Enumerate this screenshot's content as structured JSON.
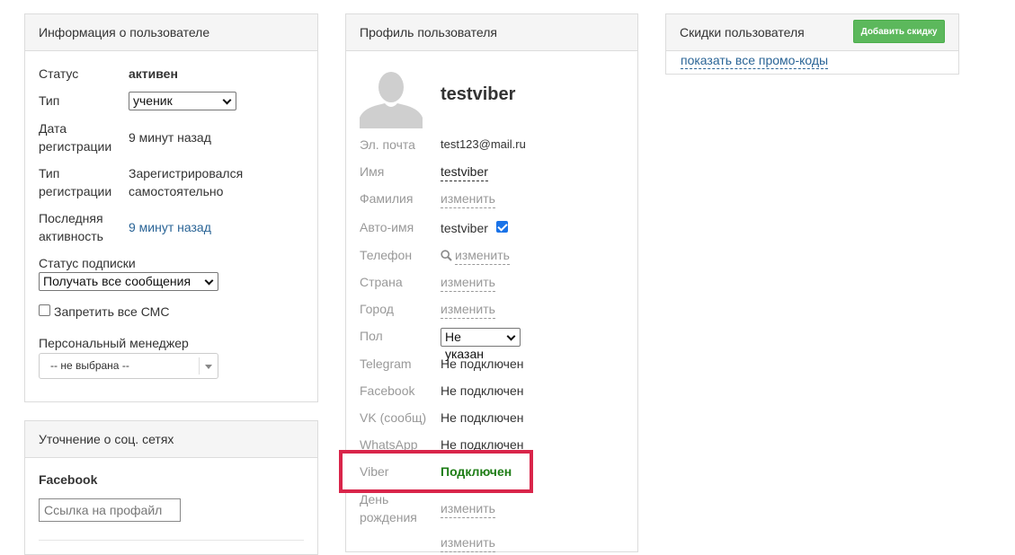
{
  "user_info": {
    "title": "Информация о пользователе",
    "status_label": "Статус",
    "status_value": "активен",
    "type_label": "Тип",
    "type_value": "ученик",
    "reg_date_label_1": "Дата",
    "reg_date_label_2": "регистрации",
    "reg_date_value": "9 минут назад",
    "reg_type_label_1": "Тип",
    "reg_type_label_2": "регистрации",
    "reg_type_value_1": "Зарегистрировался",
    "reg_type_value_2": "самостоятельно",
    "last_activity_label_1": "Последняя",
    "last_activity_label_2": "активность",
    "last_activity_value": "9 минут назад",
    "subscription_label": "Статус подписки",
    "subscription_value": "Получать все сообщения",
    "sms_label": "Запретить все СМС",
    "manager_label": "Персональный менеджер",
    "manager_value": "-- не выбрана --"
  },
  "social": {
    "title": "Уточнение о соц. сетях",
    "facebook_label": "Facebook",
    "profile_placeholder": "Ссылка на профайл"
  },
  "profile": {
    "title": "Профиль пользователя",
    "username": "testviber",
    "rows": [
      {
        "label": "Эл. почта",
        "value": "test123@mail.ru"
      },
      {
        "label": "Имя",
        "value": "testviber"
      },
      {
        "label": "Фамилия",
        "value": "изменить"
      },
      {
        "label": "Авто-имя",
        "value": "testviber"
      },
      {
        "label": "Телефон",
        "value": "изменить"
      },
      {
        "label": "Страна",
        "value": "изменить"
      },
      {
        "label": "Город",
        "value": "изменить"
      },
      {
        "label": "Пол",
        "value": "Не указан"
      },
      {
        "label": "Telegram",
        "value": "Не подключен"
      },
      {
        "label": "Facebook",
        "value": "Не подключен"
      },
      {
        "label": "VK (сообщ)",
        "value": "Не подключен"
      },
      {
        "label": "WhatsApp",
        "value": "Не подключен"
      },
      {
        "label": "Viber",
        "value": "Подключен"
      },
      {
        "label_1": "День",
        "label_2": "рождения",
        "value": "изменить"
      },
      {
        "value": "изменить"
      }
    ]
  },
  "discounts": {
    "title": "Скидки пользователя",
    "add_button": "Добавить скидку",
    "show_all_link": "показать все промо-коды"
  },
  "colors": {
    "accent_green": "#5cb85c",
    "connected_green": "#1e7d16",
    "highlight_red": "#d9254a",
    "link_blue": "#2a6496"
  }
}
